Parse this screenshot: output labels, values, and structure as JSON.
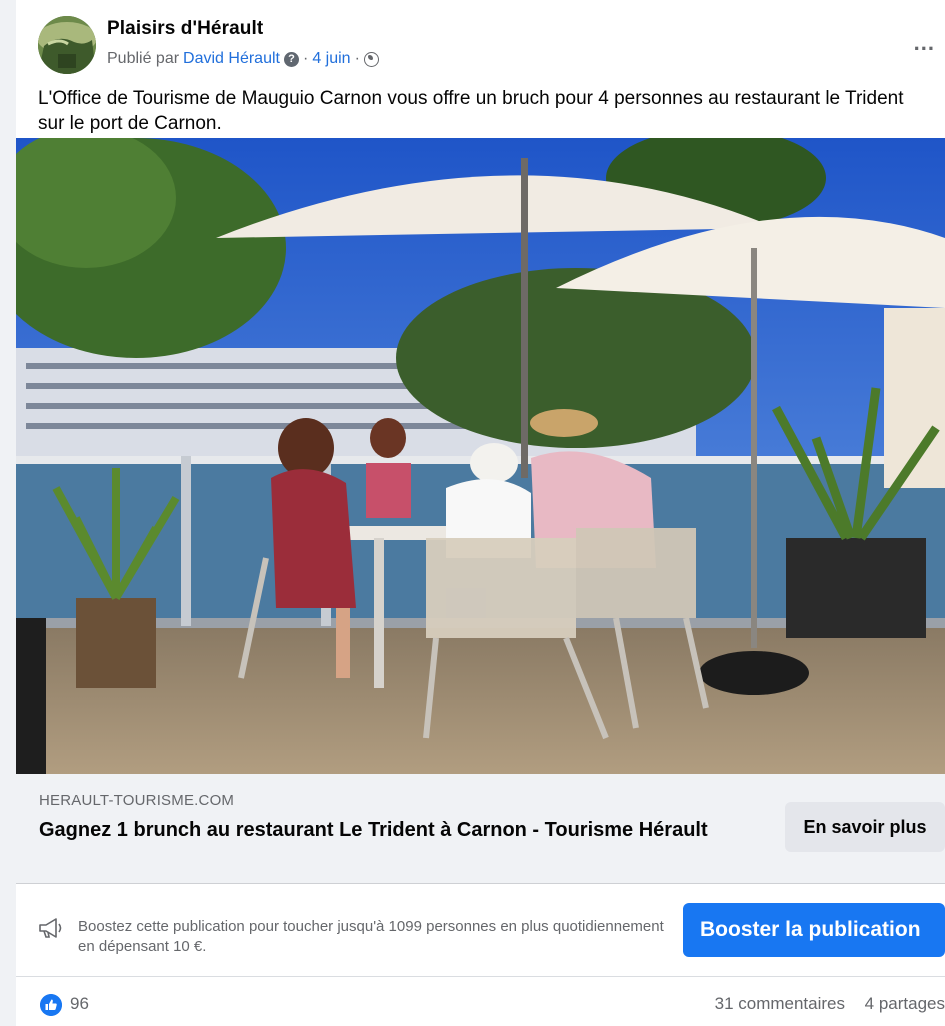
{
  "post": {
    "page_name": "Plaisirs d'Hérault",
    "published_by_prefix": "Publié par",
    "author": "David Hérault",
    "separator1": "·",
    "date": "4 juin",
    "separator2": "·",
    "more_label": "...",
    "text": "L'Office de Tourisme de Mauguio Carnon vous offre un bruch pour 4 personnes au restaurant le Trident sur le port de Carnon."
  },
  "link_preview": {
    "domain": "HERAULT-TOURISME.COM",
    "title": "Gagnez 1 brunch au restaurant Le Trident à Carnon - Tourisme Hérault",
    "button_label": "En savoir plus"
  },
  "boost": {
    "text": "Boostez cette publication pour toucher jusqu'à 1099 personnes en plus quotidiennement en dépensant 10 €.",
    "button_label": "Booster la publication"
  },
  "engagement": {
    "likes": "96",
    "comments": "31 commentaires",
    "shares": "4 partages"
  },
  "colors": {
    "accent": "#1877f2",
    "link": "#216fdb",
    "secondary_text": "#65676b"
  }
}
